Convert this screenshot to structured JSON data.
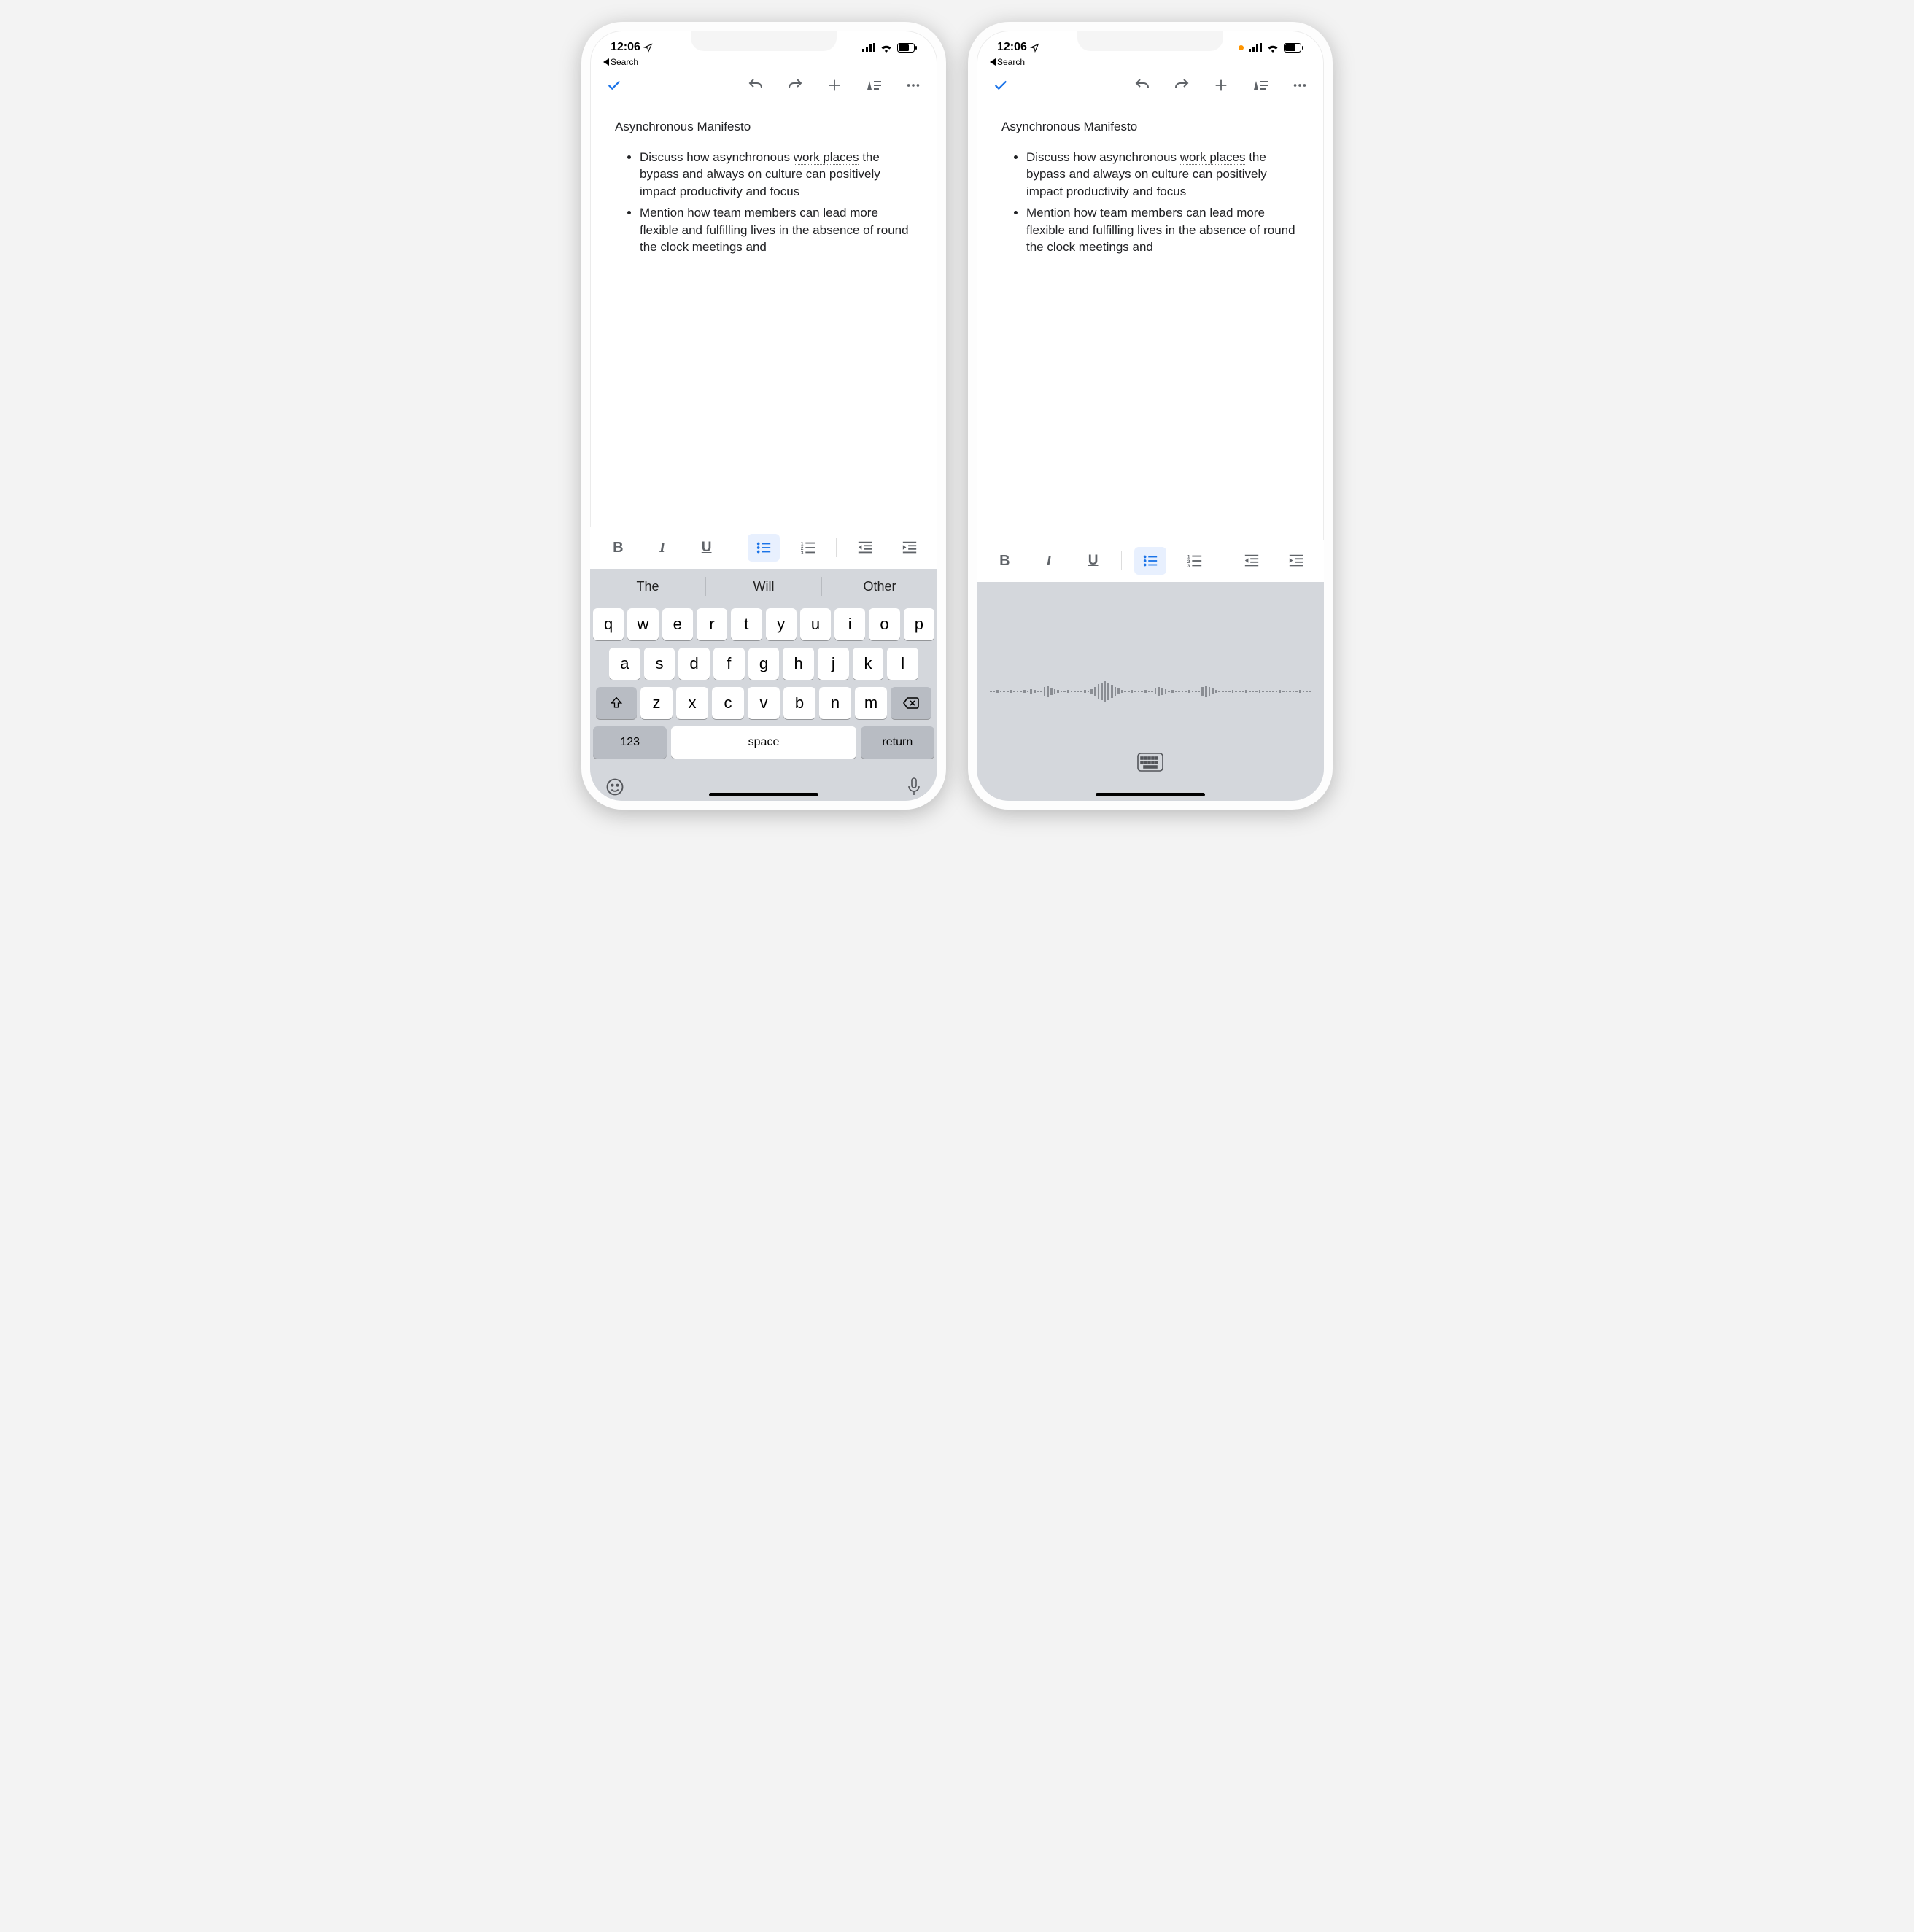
{
  "status": {
    "time": "12:06",
    "back_label": "Search"
  },
  "doc": {
    "title": "Asynchronous Manifesto",
    "bullets": [
      {
        "pre": "Discuss how asynchronous ",
        "u": "work places",
        "post": " the bypass and always on culture can positively impact productivity and focus"
      },
      {
        "pre": "Mention how team members can lead more flexible and fulfilling lives in the absence of round the clock meetings and",
        "u": "",
        "post": ""
      }
    ]
  },
  "format": {
    "bold": "B",
    "italic": "I",
    "underline": "U"
  },
  "suggestions": [
    "The",
    "Will",
    "Other"
  ],
  "keyboard": {
    "row1": [
      "q",
      "w",
      "e",
      "r",
      "t",
      "y",
      "u",
      "i",
      "o",
      "p"
    ],
    "row2": [
      "a",
      "s",
      "d",
      "f",
      "g",
      "h",
      "j",
      "k",
      "l"
    ],
    "row3": [
      "z",
      "x",
      "c",
      "v",
      "b",
      "n",
      "m"
    ],
    "numkey": "123",
    "space": "space",
    "returnkey": "return"
  }
}
